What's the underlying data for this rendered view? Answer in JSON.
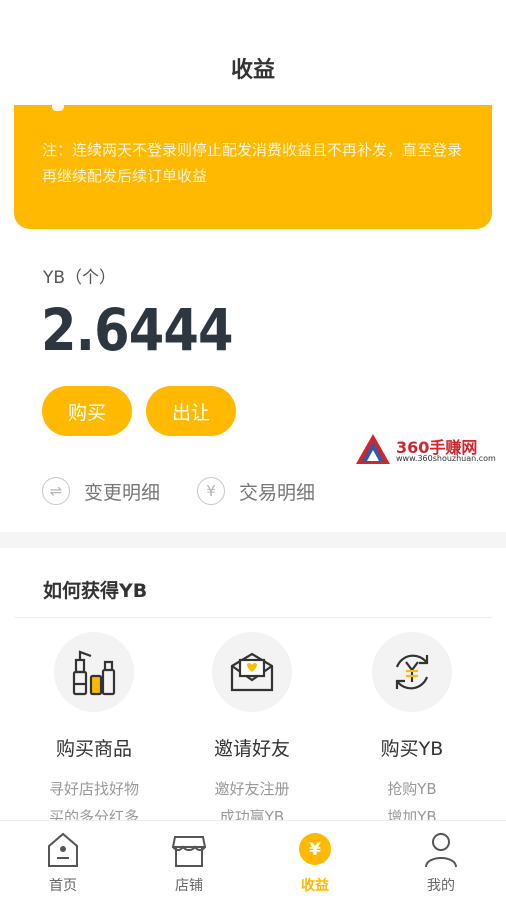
{
  "header": {
    "title": "收益"
  },
  "notice": {
    "text": "注：连续两天不登录则停止配发消费收益且不再补发，直至登录再继续配发后续订单收益"
  },
  "balance": {
    "unit_label": "YB（个）",
    "amount": "2.6444",
    "buy_label": "购买",
    "sell_label": "出让"
  },
  "details": {
    "change_label": "变更明细",
    "trade_label": "交易明细"
  },
  "watermark": {
    "name": "360手赚网",
    "url": "www.360shouzhuan.com"
  },
  "earn": {
    "title": "如何获得YB",
    "cards": [
      {
        "title": "购买商品",
        "desc1": "寻好店找好物",
        "desc2": "买的多分红多",
        "icon": "cosmetics-icon"
      },
      {
        "title": "邀请好友",
        "desc1": "邀好友注册",
        "desc2": "成功赢YB",
        "icon": "invite-envelope-icon"
      },
      {
        "title": "购买YB",
        "desc1": "抢购YB",
        "desc2": "增加YB",
        "icon": "currency-exchange-icon"
      }
    ]
  },
  "tabbar": {
    "items": [
      {
        "label": "首页",
        "icon": "home-icon"
      },
      {
        "label": "店铺",
        "icon": "store-icon"
      },
      {
        "label": "收益",
        "icon": "yen-icon",
        "active": true
      },
      {
        "label": "我的",
        "icon": "user-icon"
      }
    ]
  },
  "colors": {
    "accent": "#FFB900",
    "text_dark": "#2e3740",
    "text_muted": "#999999"
  }
}
